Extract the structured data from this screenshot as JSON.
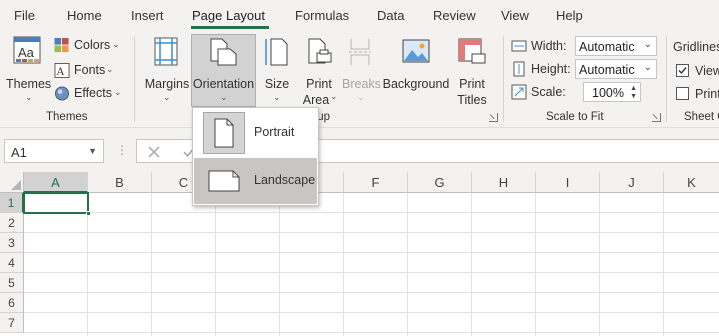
{
  "tabs": [
    "File",
    "Home",
    "Insert",
    "Page Layout",
    "Formulas",
    "Data",
    "Review",
    "View",
    "Help"
  ],
  "active_tab": "Page Layout",
  "accent_color": "#217346",
  "ribbon": {
    "themes_group": {
      "label": "Themes",
      "themes_button": "Themes",
      "colors": "Colors",
      "fonts": "Fonts",
      "effects": "Effects"
    },
    "page_setup_group": {
      "label_visible_part": "tup",
      "margins": "Margins",
      "orientation": "Orientation",
      "size": "Size",
      "print_area": [
        "Print",
        "Area"
      ],
      "breaks": "Breaks",
      "background": "Background",
      "print_titles": [
        "Print",
        "Titles"
      ]
    },
    "scale_to_fit_group": {
      "label": "Scale to Fit",
      "width_label": "Width:",
      "width_value": "Automatic",
      "height_label": "Height:",
      "height_value": "Automatic",
      "scale_label": "Scale:",
      "scale_value": "100%"
    },
    "sheet_options_group": {
      "label": "Sheet O",
      "gridlines": "Gridlines",
      "view": "View",
      "print": "Print"
    }
  },
  "orientation_menu": {
    "items": [
      {
        "label": "Portrait",
        "icon": "portrait-page-icon"
      },
      {
        "label": "Landscape",
        "icon": "landscape-page-icon",
        "hover": true
      }
    ]
  },
  "formula_bar": {
    "name_box": "A1",
    "cancel_icon": "x-icon",
    "enter_icon": "check-icon"
  },
  "sheet": {
    "columns": [
      "A",
      "B",
      "C",
      "D",
      "E",
      "F",
      "G",
      "H",
      "I",
      "J",
      "K"
    ],
    "rows": [
      "1",
      "2",
      "3",
      "4",
      "5",
      "6",
      "7"
    ],
    "selected_cell": "A1"
  }
}
